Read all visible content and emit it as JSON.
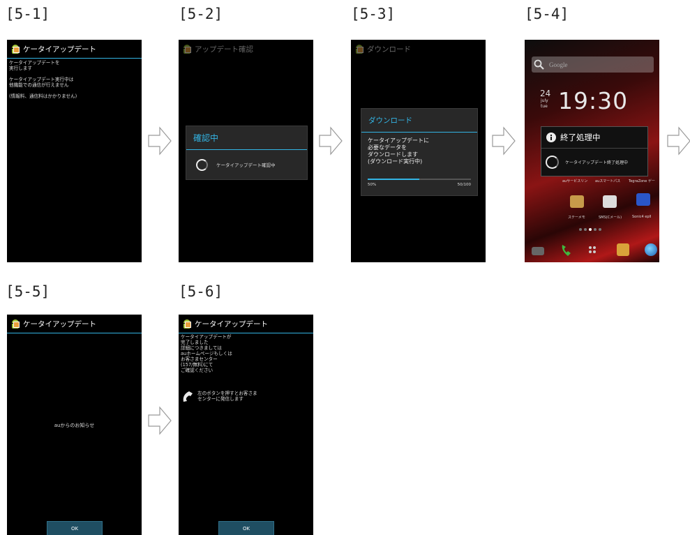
{
  "steps": {
    "s1": "[5-1]",
    "s2": "[5-2]",
    "s3": "[5-3]",
    "s4": "[5-4]",
    "s5": "[5-5]",
    "s6": "[5-6]"
  },
  "screen1": {
    "title": "ケータイアップデート",
    "lines": [
      "ケータイアップデートを",
      "実行します",
      "",
      "ケータイアップデート実行中は",
      "他機能での通信が行えません",
      "",
      "(情報料、通信料はかかりません)"
    ]
  },
  "screen2": {
    "title": "アップデート確認",
    "dialog_title": "確認中",
    "dialog_message": "ケータイアップデート確認中"
  },
  "screen3": {
    "title": "ダウンロード",
    "dialog_title": "ダウンロード",
    "message": "ケータイアップデートに\n必要なデータを\nダウンロードします\n(ダウンロード実行中)",
    "progress_percent": "50%",
    "progress_count": "50/100",
    "progress_value": 0.5
  },
  "screen4": {
    "search_placeholder": "Google",
    "date_day": "24",
    "date_month": "july",
    "date_weekday": "tue",
    "clock": "19:30",
    "dialog_title": "終了処理中",
    "dialog_message": "ケータイアップデート終了処理中",
    "widget_labels": [
      "auサービスリン",
      "auスマートパス",
      "TegraZone ゲー"
    ],
    "app_labels": [
      "ステーメモ",
      "SMS(Cメール)",
      "Sonic4 epII"
    ]
  },
  "screen5": {
    "title": "ケータイアップデート",
    "notice": "auからのお知らせ",
    "ok_label": "OK"
  },
  "screen6": {
    "title": "ケータイアップデート",
    "lines": [
      "ケータイアップデートが",
      "完了しました",
      "詳細につきましては",
      "auホームページもしくは",
      "お客さまセンター",
      "(157/無料)にて",
      "ご確認ください"
    ],
    "call_text_1": "左のボタンを押すとお客さま",
    "call_text_2": "センターに発信します",
    "ok_label": "OK"
  },
  "colors": {
    "accent": "#33b5e5",
    "screen_bg": "#000000",
    "dialog_bg": "#282828"
  }
}
